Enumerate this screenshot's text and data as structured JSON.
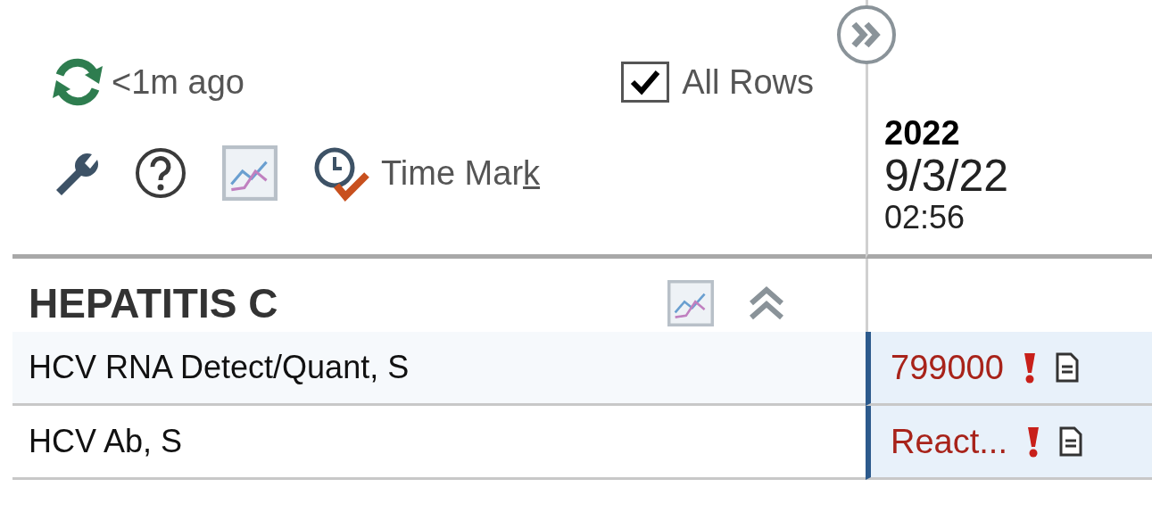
{
  "refresh": {
    "label": "<1m ago"
  },
  "all_rows": {
    "label": "All Rows",
    "checked": true
  },
  "time_mark": {
    "label": "Time Mark"
  },
  "column": {
    "year": "2022",
    "date": "9/3/22",
    "time": "02:56"
  },
  "section": {
    "title": "HEPATITIS C",
    "expanded": true
  },
  "rows": [
    {
      "name": "HCV RNA Detect/Quant, S",
      "value": "799000",
      "abnormal": true
    },
    {
      "name": "HCV Ab, S",
      "value": "React...",
      "abnormal": true
    }
  ]
}
